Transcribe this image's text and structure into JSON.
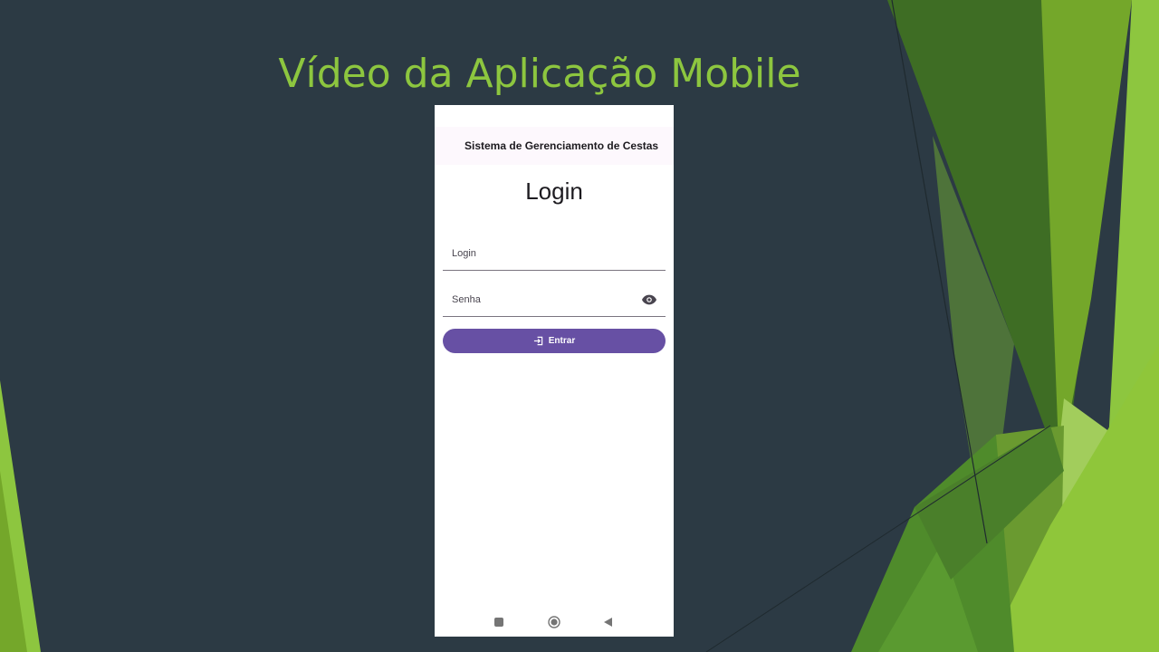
{
  "slide": {
    "title": "Vídeo da Aplicação Mobile",
    "colors": {
      "background": "#2c3a44",
      "accent": "#8dc63f"
    }
  },
  "app": {
    "appbar_title": "Sistema de Gerenciamento de Cestas",
    "heading": "Login",
    "login_field": {
      "placeholder": "Login",
      "value": ""
    },
    "password_field": {
      "placeholder": "Senha",
      "value": "",
      "toggle_icon": "eye-icon"
    },
    "submit_button": {
      "label": "Entrar",
      "icon": "login-icon",
      "color": "#6750a4"
    },
    "system_nav": {
      "icons": [
        "recents-icon",
        "home-icon",
        "back-icon"
      ]
    }
  }
}
